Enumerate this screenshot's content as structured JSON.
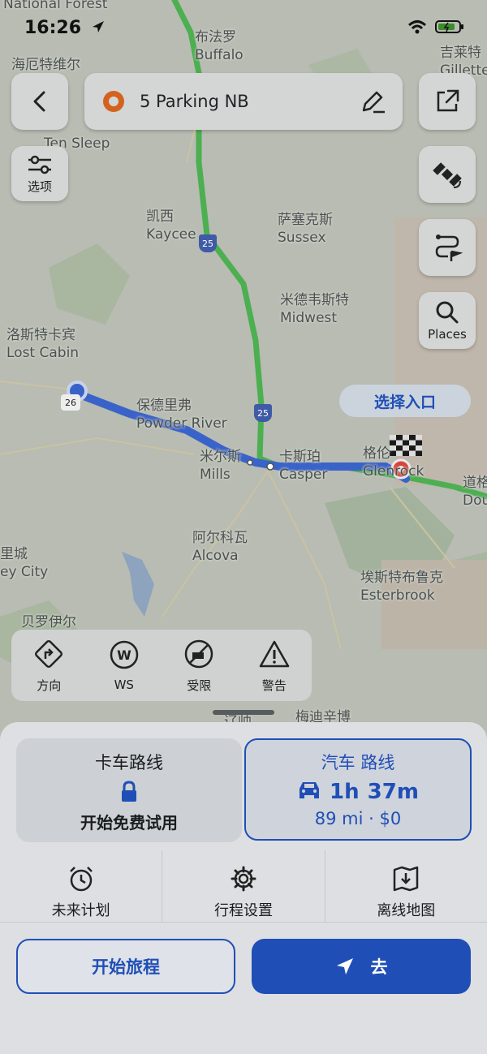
{
  "status": {
    "time": "16:26"
  },
  "map": {
    "places": [
      {
        "zh": "",
        "en": "National Forest"
      },
      {
        "zh": "布法罗",
        "en": "Buffalo"
      },
      {
        "zh": "吉莱特",
        "en": "Gillette"
      },
      {
        "zh": "海厄特维尔",
        "en": ""
      },
      {
        "zh": "",
        "en": "Ten Sleep"
      },
      {
        "zh": "凯西",
        "en": "Kaycee"
      },
      {
        "zh": "萨塞克斯",
        "en": "Sussex"
      },
      {
        "zh": "米德韦斯特",
        "en": "Midwest"
      },
      {
        "zh": "洛斯特卡宾",
        "en": "Lost Cabin"
      },
      {
        "zh": "保德里弗",
        "en": "Powder River"
      },
      {
        "zh": "米尔斯",
        "en": "Mills"
      },
      {
        "zh": "卡斯珀",
        "en": "Casper"
      },
      {
        "zh": "格伦",
        "en": "Glenrock"
      },
      {
        "zh": "道格",
        "en": "Dou"
      },
      {
        "zh": "阿尔科瓦",
        "en": "Alcova"
      },
      {
        "zh": "里城",
        "en": "ey City"
      },
      {
        "zh": "埃斯特布鲁克",
        "en": "Esterbrook"
      },
      {
        "zh": "贝罗伊尔",
        "en": ""
      },
      {
        "zh": "梅迪辛博",
        "en": ""
      },
      {
        "zh": "辽帅",
        "en": ""
      }
    ],
    "shields": [
      "25",
      "25",
      "26"
    ],
    "entry_chip": "选择入口"
  },
  "topbar": {
    "destination": "5 Parking NB"
  },
  "side_buttons": {
    "options_label": "选项",
    "places_label": "Places"
  },
  "toolstrip": [
    {
      "label": "方向",
      "icon": "turn-direction-icon"
    },
    {
      "label": "WS",
      "icon": "weigh-station-icon"
    },
    {
      "label": "受限",
      "icon": "restricted-icon"
    },
    {
      "label": "警告",
      "icon": "warning-icon"
    }
  ],
  "routes": {
    "truck": {
      "title": "卡车路线",
      "cta": "开始免费试用"
    },
    "car": {
      "title": "汽车 路线",
      "duration_h": "1h",
      "duration_m": "37m",
      "distance": "89 mi · $0"
    }
  },
  "actions": [
    {
      "label": "未来计划",
      "icon": "alarm-clock-icon"
    },
    {
      "label": "行程设置",
      "icon": "gear-icon"
    },
    {
      "label": "离线地图",
      "icon": "offline-map-icon"
    }
  ],
  "buttons": {
    "start_trip": "开始旅程",
    "go": "去"
  },
  "colors": {
    "accent": "#1f4fb6",
    "route": "#3a63c9",
    "highway": "#4caf50",
    "destination": "#d9433a"
  }
}
